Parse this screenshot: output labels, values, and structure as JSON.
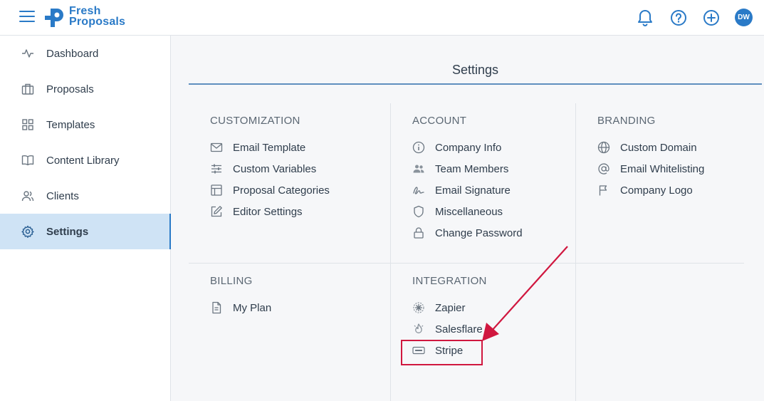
{
  "header": {
    "logo_line1": "Fresh",
    "logo_line2": "Proposals",
    "avatar_initials": "DW",
    "icons": [
      "bell-icon",
      "help-icon",
      "add-icon"
    ]
  },
  "sidebar": {
    "items": [
      {
        "label": "Dashboard",
        "icon": "activity-icon"
      },
      {
        "label": "Proposals",
        "icon": "briefcase-icon"
      },
      {
        "label": "Templates",
        "icon": "grid-icon"
      },
      {
        "label": "Content Library",
        "icon": "book-icon"
      },
      {
        "label": "Clients",
        "icon": "users-icon"
      },
      {
        "label": "Settings",
        "icon": "gear-icon",
        "active": true
      }
    ]
  },
  "main": {
    "title": "Settings",
    "sections": {
      "customization": {
        "title": "CUSTOMIZATION",
        "items": [
          "Email Template",
          "Custom Variables",
          "Proposal Categories",
          "Editor Settings"
        ]
      },
      "account": {
        "title": "ACCOUNT",
        "items": [
          "Company Info",
          "Team Members",
          "Email Signature",
          "Miscellaneous",
          "Change Password"
        ]
      },
      "branding": {
        "title": "BRANDING",
        "items": [
          "Custom Domain",
          "Email Whitelisting",
          "Company Logo"
        ]
      },
      "billing": {
        "title": "BILLING",
        "items": [
          "My Plan"
        ]
      },
      "integration": {
        "title": "INTEGRATION",
        "items": [
          "Zapier",
          "Salesflare",
          "Stripe"
        ]
      }
    }
  },
  "colors": {
    "accent": "#2a7ac7",
    "active_bg": "#cfe3f5",
    "annotation": "#d0173f"
  }
}
